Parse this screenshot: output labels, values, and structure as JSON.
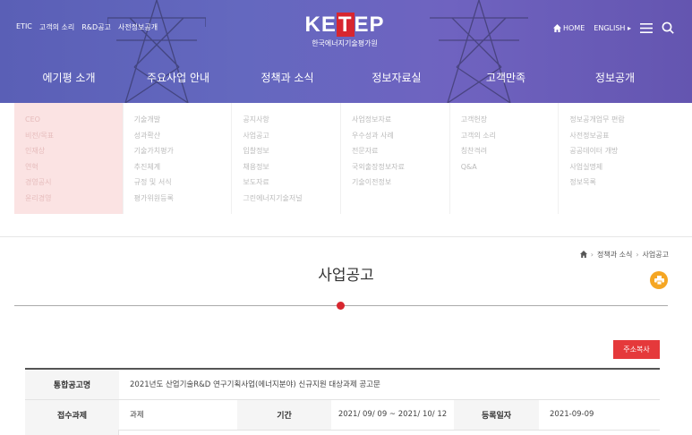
{
  "header": {
    "util_links": [
      "ETIC",
      "고객의 소리",
      "R&D공고",
      "사전정보공개"
    ],
    "logo": {
      "word_a": "KE",
      "word_b": "T",
      "word_c": "EP",
      "subtitle": "한국에너지기술평가원"
    },
    "right_util": {
      "home": "HOME",
      "lang": "ENGLISH"
    },
    "gnb": [
      "에기평 소개",
      "주요사업 안내",
      "정책과 소식",
      "정보자료실",
      "고객만족",
      "정보공개"
    ]
  },
  "mega_menu": [
    [
      "CEO",
      "비전/목표",
      "인재상",
      "연혁",
      "경영공시",
      "윤리경영"
    ],
    [
      "기술개발",
      "성과확산",
      "기술가치평가",
      "추진체계",
      "규정 및 서식",
      "평가위원등록"
    ],
    [
      "공지사항",
      "사업공고",
      "입찰정보",
      "채용정보",
      "보도자료",
      "그린에너지기술저널"
    ],
    [
      "사업정보자료",
      "우수성과 사례",
      "전문자료",
      "국외출장정보자료",
      "기술이전정보"
    ],
    [
      "고객헌장",
      "고객의 소리",
      "칭찬격려",
      "Q&A"
    ],
    [
      "정보공개업무 편람",
      "사전정보공표",
      "공공데이터 개방",
      "사업실명제",
      "정보목록"
    ]
  ],
  "breadcrumb": [
    "정책과 소식",
    "사업공고"
  ],
  "page_title": "사업공고",
  "copy_button": "주소복사",
  "table": {
    "title_label": "통합공고명",
    "title_value": "2021년도 산업기술R&D 연구기획사업(에너지분야) 신규지원 대상과제 공고문",
    "task_label": "접수과제",
    "task_value": "과제",
    "period_label": "기간",
    "period_value": "2021/ 09/ 09 ~ 2021/ 10/ 12",
    "date_label": "등록일자",
    "date_value": "2021-09-09"
  },
  "colors": {
    "brand_red": "#d7262f",
    "header_purple": "#6468bf",
    "print_orange": "#f5a623"
  }
}
